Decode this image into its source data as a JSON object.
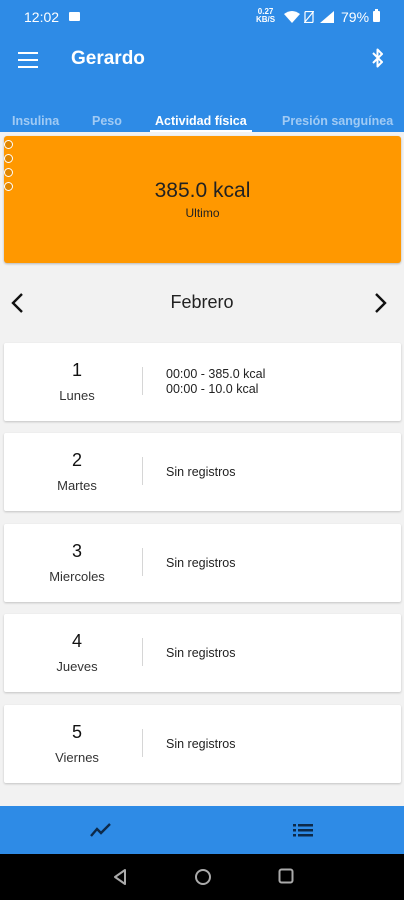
{
  "status": {
    "time": "12:02",
    "speed_top": "0.27",
    "speed_bottom": "KB/S",
    "battery": "79%"
  },
  "appbar": {
    "title": "Gerardo"
  },
  "tabs": [
    {
      "label": "Insulina",
      "active": false
    },
    {
      "label": "Peso",
      "active": false
    },
    {
      "label": "Actividad física",
      "active": true
    },
    {
      "label": "Presión sanguínea",
      "active": false
    }
  ],
  "summary": {
    "value": "385.0 kcal",
    "label": "Ultimo",
    "color": "#ff9800"
  },
  "month": "Febrero",
  "days": [
    {
      "number": "1",
      "name": "Lunes",
      "entries": [
        "00:00 - 385.0 kcal",
        "00:00 - 10.0 kcal"
      ]
    },
    {
      "number": "2",
      "name": "Martes",
      "entries": [
        "Sin registros"
      ]
    },
    {
      "number": "3",
      "name": "Miercoles",
      "entries": [
        "Sin registros"
      ]
    },
    {
      "number": "4",
      "name": "Jueves",
      "entries": [
        "Sin registros"
      ]
    },
    {
      "number": "5",
      "name": "Viernes",
      "entries": [
        "Sin registros"
      ]
    }
  ],
  "bottom_nav": {
    "icons": [
      "chart-trend-icon",
      "list-icon"
    ]
  },
  "system_nav": {
    "icons": [
      "back-icon",
      "home-icon",
      "recents-icon"
    ]
  },
  "colors": {
    "primary": "#2e8be6",
    "accent": "#ff9800"
  }
}
